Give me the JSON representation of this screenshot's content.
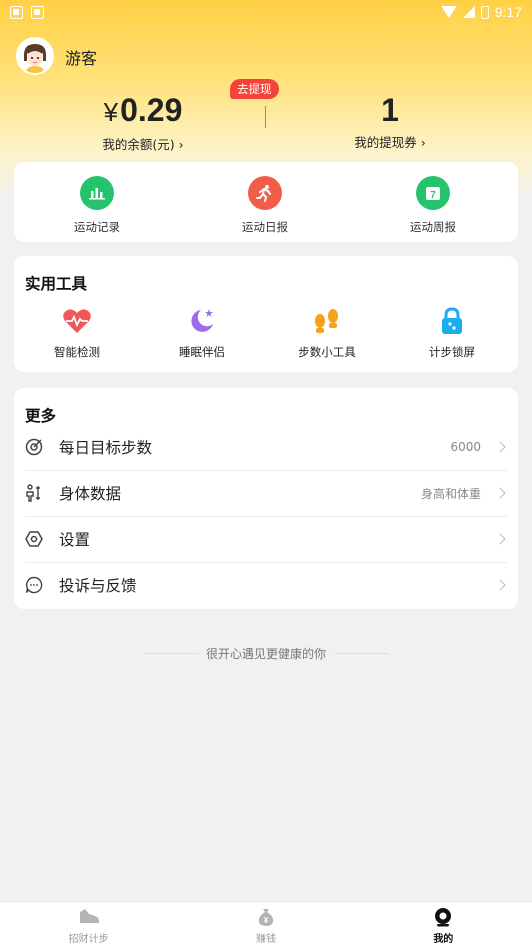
{
  "status_bar": {
    "time": "9:17"
  },
  "profile": {
    "username": "游客"
  },
  "wallet": {
    "currency_symbol": "¥",
    "balance": "0.29",
    "balance_label": "我的余额(元) ›",
    "withdraw_tag": "去提现",
    "voucher_count": "1",
    "voucher_label": "我的提现券 ›"
  },
  "records": [
    {
      "label": "运动记录",
      "color": "#25c36b"
    },
    {
      "label": "运动日报",
      "color": "#f25d4a"
    },
    {
      "label": "运动周报",
      "color": "#25c36b"
    }
  ],
  "tools": {
    "title": "实用工具",
    "items": [
      {
        "label": "智能检测",
        "color": "#f2555a"
      },
      {
        "label": "睡眠伴侣",
        "color": "#9b6bf0"
      },
      {
        "label": "步数小工具",
        "color": "#f6a21b"
      },
      {
        "label": "计步锁屏",
        "color": "#1aaef0"
      }
    ]
  },
  "more": {
    "title": "更多",
    "rows": [
      {
        "label": "每日目标步数",
        "value": "6000"
      },
      {
        "label": "身体数据",
        "value": "身高和体重"
      },
      {
        "label": "设置",
        "value": ""
      },
      {
        "label": "投诉与反馈",
        "value": ""
      }
    ]
  },
  "slogan": "很开心遇见更健康的你",
  "tabbar": [
    {
      "label": "招财计步",
      "active": false
    },
    {
      "label": "赚钱",
      "active": false
    },
    {
      "label": "我的",
      "active": true
    }
  ]
}
